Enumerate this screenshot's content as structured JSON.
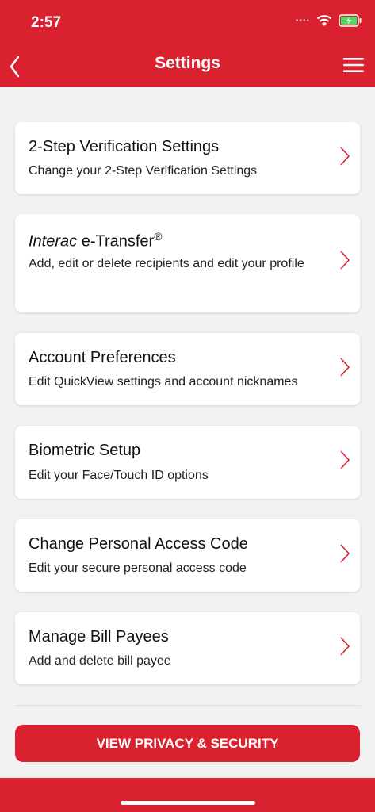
{
  "status_bar": {
    "time": "2:57"
  },
  "header": {
    "title": "Settings"
  },
  "cards": [
    {
      "title": "2-Step Verification Settings",
      "description": "Change your 2-Step Verification Settings"
    },
    {
      "title_italic": "Interac",
      "title_rest": " e-Transfer",
      "title_sup": "®",
      "description": "Add, edit or delete recipients and edit your profile"
    },
    {
      "title": "Account Preferences",
      "description": "Edit QuickView settings and account nicknames"
    },
    {
      "title": "Biometric Setup",
      "description": "Edit your Face/Touch ID options"
    },
    {
      "title": "Change Personal Access Code",
      "description": "Edit your secure personal access code"
    },
    {
      "title": "Manage Bill Payees",
      "description": "Add and delete bill payee"
    }
  ],
  "privacy_button": {
    "label": "VIEW PRIVACY & SECURITY"
  },
  "colors": {
    "brand_red": "#d9212f",
    "background": "#f2f2f2",
    "battery_green": "#4cd964"
  },
  "icons": {
    "back": "chevron-left-icon",
    "menu": "hamburger-menu-icon",
    "row": "chevron-right-icon",
    "wifi": "wifi-icon",
    "battery": "battery-charging-icon"
  }
}
